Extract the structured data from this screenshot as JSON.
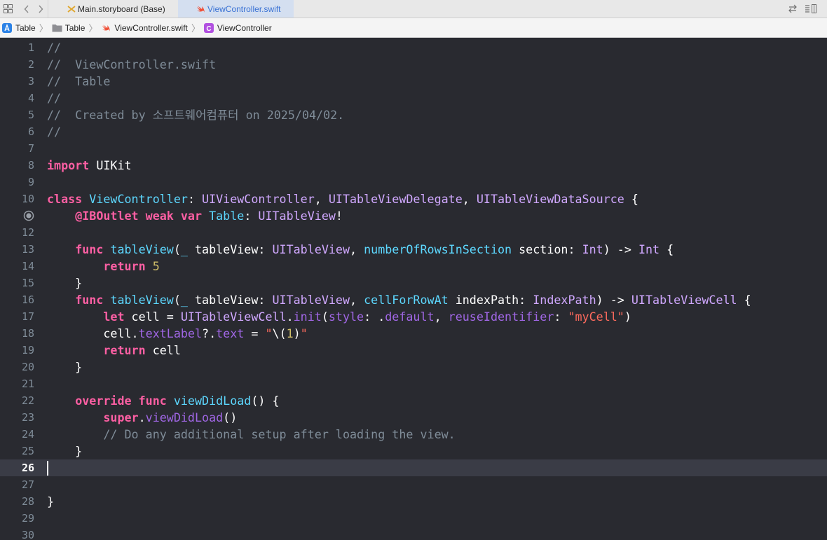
{
  "tabs": [
    {
      "label": "Main.storyboard (Base)",
      "icon": "storyboard-icon",
      "active": false
    },
    {
      "label": "ViewController.swift",
      "icon": "swift-icon",
      "active": true
    }
  ],
  "breadcrumb": [
    {
      "label": "Table",
      "icon": "app-project-icon"
    },
    {
      "label": "Table",
      "icon": "folder-icon"
    },
    {
      "label": "ViewController.swift",
      "icon": "swift-icon"
    },
    {
      "label": "ViewController",
      "icon": "class-icon"
    }
  ],
  "editor": {
    "current_line": 26,
    "breakpoint_line": 11,
    "lines": [
      {
        "n": "1",
        "tokens": [
          {
            "t": "//",
            "c": "cm"
          }
        ]
      },
      {
        "n": "2",
        "tokens": [
          {
            "t": "//  ViewController.swift",
            "c": "cm"
          }
        ]
      },
      {
        "n": "3",
        "tokens": [
          {
            "t": "//  Table",
            "c": "cm"
          }
        ]
      },
      {
        "n": "4",
        "tokens": [
          {
            "t": "//",
            "c": "cm"
          }
        ]
      },
      {
        "n": "5",
        "tokens": [
          {
            "t": "//  Created by 소프트웨어컴퓨터 on 2025/04/02.",
            "c": "cm"
          }
        ]
      },
      {
        "n": "6",
        "tokens": [
          {
            "t": "//",
            "c": "cm"
          }
        ]
      },
      {
        "n": "7",
        "tokens": []
      },
      {
        "n": "8",
        "tokens": [
          {
            "t": "import",
            "c": "kw"
          },
          {
            "t": " UIKit",
            "c": "pl"
          }
        ]
      },
      {
        "n": "9",
        "tokens": []
      },
      {
        "n": "10",
        "tokens": [
          {
            "t": "class",
            "c": "kw"
          },
          {
            "t": " ",
            "c": "pl"
          },
          {
            "t": "ViewController",
            "c": "tyd"
          },
          {
            "t": ": ",
            "c": "pl"
          },
          {
            "t": "UIViewController",
            "c": "ty"
          },
          {
            "t": ", ",
            "c": "pl"
          },
          {
            "t": "UITableViewDelegate",
            "c": "ty"
          },
          {
            "t": ", ",
            "c": "pl"
          },
          {
            "t": "UITableViewDataSource",
            "c": "ty"
          },
          {
            "t": " {",
            "c": "pl"
          }
        ]
      },
      {
        "n": "",
        "tokens": [
          {
            "t": "    ",
            "c": "pl"
          },
          {
            "t": "@IBOutlet",
            "c": "kw"
          },
          {
            "t": " ",
            "c": "pl"
          },
          {
            "t": "weak",
            "c": "kw"
          },
          {
            "t": " ",
            "c": "pl"
          },
          {
            "t": "var",
            "c": "kw"
          },
          {
            "t": " ",
            "c": "pl"
          },
          {
            "t": "Table",
            "c": "tyd"
          },
          {
            "t": ": ",
            "c": "pl"
          },
          {
            "t": "UITableView",
            "c": "ty"
          },
          {
            "t": "!",
            "c": "pl"
          }
        ]
      },
      {
        "n": "12",
        "tokens": []
      },
      {
        "n": "13",
        "tokens": [
          {
            "t": "    ",
            "c": "pl"
          },
          {
            "t": "func",
            "c": "kw"
          },
          {
            "t": " ",
            "c": "pl"
          },
          {
            "t": "tableView",
            "c": "tyd"
          },
          {
            "t": "(",
            "c": "pl"
          },
          {
            "t": "_",
            "c": "tyd"
          },
          {
            "t": " tableView: ",
            "c": "pl"
          },
          {
            "t": "UITableView",
            "c": "ty"
          },
          {
            "t": ", ",
            "c": "pl"
          },
          {
            "t": "numberOfRowsInSection",
            "c": "tyd"
          },
          {
            "t": " section: ",
            "c": "pl"
          },
          {
            "t": "Int",
            "c": "ty"
          },
          {
            "t": ") -> ",
            "c": "pl"
          },
          {
            "t": "Int",
            "c": "ty"
          },
          {
            "t": " {",
            "c": "pl"
          }
        ]
      },
      {
        "n": "14",
        "tokens": [
          {
            "t": "        ",
            "c": "pl"
          },
          {
            "t": "return",
            "c": "kw"
          },
          {
            "t": " ",
            "c": "pl"
          },
          {
            "t": "5",
            "c": "nm"
          }
        ]
      },
      {
        "n": "15",
        "tokens": [
          {
            "t": "    }",
            "c": "pl"
          }
        ]
      },
      {
        "n": "16",
        "tokens": [
          {
            "t": "    ",
            "c": "pl"
          },
          {
            "t": "func",
            "c": "kw"
          },
          {
            "t": " ",
            "c": "pl"
          },
          {
            "t": "tableView",
            "c": "tyd"
          },
          {
            "t": "(",
            "c": "pl"
          },
          {
            "t": "_",
            "c": "tyd"
          },
          {
            "t": " tableView: ",
            "c": "pl"
          },
          {
            "t": "UITableView",
            "c": "ty"
          },
          {
            "t": ", ",
            "c": "pl"
          },
          {
            "t": "cellForRowAt",
            "c": "tyd"
          },
          {
            "t": " indexPath: ",
            "c": "pl"
          },
          {
            "t": "IndexPath",
            "c": "ty"
          },
          {
            "t": ") -> ",
            "c": "pl"
          },
          {
            "t": "UITableViewCell",
            "c": "ty"
          },
          {
            "t": " {",
            "c": "pl"
          }
        ]
      },
      {
        "n": "17",
        "tokens": [
          {
            "t": "        ",
            "c": "pl"
          },
          {
            "t": "let",
            "c": "kw"
          },
          {
            "t": " cell = ",
            "c": "pl"
          },
          {
            "t": "UITableViewCell",
            "c": "ty"
          },
          {
            "t": ".",
            "c": "pl"
          },
          {
            "t": "init",
            "c": "prop"
          },
          {
            "t": "(",
            "c": "pl"
          },
          {
            "t": "style",
            "c": "prop"
          },
          {
            "t": ": .",
            "c": "pl"
          },
          {
            "t": "default",
            "c": "prop"
          },
          {
            "t": ", ",
            "c": "pl"
          },
          {
            "t": "reuseIdentifier",
            "c": "prop"
          },
          {
            "t": ": ",
            "c": "pl"
          },
          {
            "t": "\"myCell\"",
            "c": "st"
          },
          {
            "t": ")",
            "c": "pl"
          }
        ]
      },
      {
        "n": "18",
        "tokens": [
          {
            "t": "        cell.",
            "c": "pl"
          },
          {
            "t": "textLabel",
            "c": "prop"
          },
          {
            "t": "?.",
            "c": "pl"
          },
          {
            "t": "text",
            "c": "prop"
          },
          {
            "t": " = ",
            "c": "pl"
          },
          {
            "t": "\"",
            "c": "st"
          },
          {
            "t": "\\(",
            "c": "pl"
          },
          {
            "t": "1",
            "c": "nm"
          },
          {
            "t": ")",
            "c": "pl"
          },
          {
            "t": "\"",
            "c": "st"
          }
        ]
      },
      {
        "n": "19",
        "tokens": [
          {
            "t": "        ",
            "c": "pl"
          },
          {
            "t": "return",
            "c": "kw"
          },
          {
            "t": " cell",
            "c": "pl"
          }
        ]
      },
      {
        "n": "20",
        "tokens": [
          {
            "t": "    }",
            "c": "pl"
          }
        ]
      },
      {
        "n": "21",
        "tokens": []
      },
      {
        "n": "22",
        "tokens": [
          {
            "t": "    ",
            "c": "pl"
          },
          {
            "t": "override",
            "c": "kw"
          },
          {
            "t": " ",
            "c": "pl"
          },
          {
            "t": "func",
            "c": "kw"
          },
          {
            "t": " ",
            "c": "pl"
          },
          {
            "t": "viewDidLoad",
            "c": "tyd"
          },
          {
            "t": "() {",
            "c": "pl"
          }
        ]
      },
      {
        "n": "23",
        "tokens": [
          {
            "t": "        ",
            "c": "pl"
          },
          {
            "t": "super",
            "c": "kw"
          },
          {
            "t": ".",
            "c": "pl"
          },
          {
            "t": "viewDidLoad",
            "c": "prop"
          },
          {
            "t": "()",
            "c": "pl"
          }
        ]
      },
      {
        "n": "24",
        "tokens": [
          {
            "t": "        ",
            "c": "pl"
          },
          {
            "t": "// Do any additional setup after loading the view.",
            "c": "cm"
          }
        ]
      },
      {
        "n": "25",
        "tokens": [
          {
            "t": "    }",
            "c": "pl"
          }
        ]
      },
      {
        "n": "26",
        "tokens": []
      },
      {
        "n": "27",
        "tokens": []
      },
      {
        "n": "28",
        "tokens": [
          {
            "t": "}",
            "c": "pl"
          }
        ]
      },
      {
        "n": "29",
        "tokens": []
      },
      {
        "n": "30",
        "tokens": []
      }
    ]
  },
  "colors": {
    "background": "#292a30",
    "current_line": "#3a3c46",
    "keyword": "#fc5fa3",
    "type": "#d0a8ff",
    "declaration": "#5dd8ff",
    "comment": "#7f8c98",
    "string": "#fc6a5d",
    "number": "#d0bf69"
  }
}
